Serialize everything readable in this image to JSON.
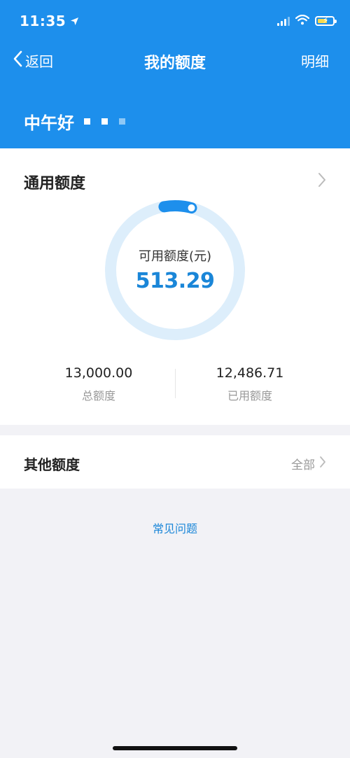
{
  "status_bar": {
    "time": "11:35"
  },
  "nav": {
    "back_label": "返回",
    "title": "我的额度",
    "detail_label": "明细"
  },
  "greeting": {
    "text": "中午好"
  },
  "general_quota": {
    "title": "通用额度",
    "available_label": "可用额度(元)",
    "available_value": "513.29",
    "total_value": "13,000.00",
    "total_label": "总额度",
    "used_value": "12,486.71",
    "used_label": "已用额度",
    "available_fraction": 0.0395
  },
  "other_quota": {
    "title": "其他额度",
    "all_label": "全部"
  },
  "faq": {
    "label": "常见问题"
  },
  "colors": {
    "brand": "#1d8fec",
    "ring_track": "#ddeefb",
    "ring_fill": "#1d8fec",
    "accent_text": "#1a86d8"
  }
}
